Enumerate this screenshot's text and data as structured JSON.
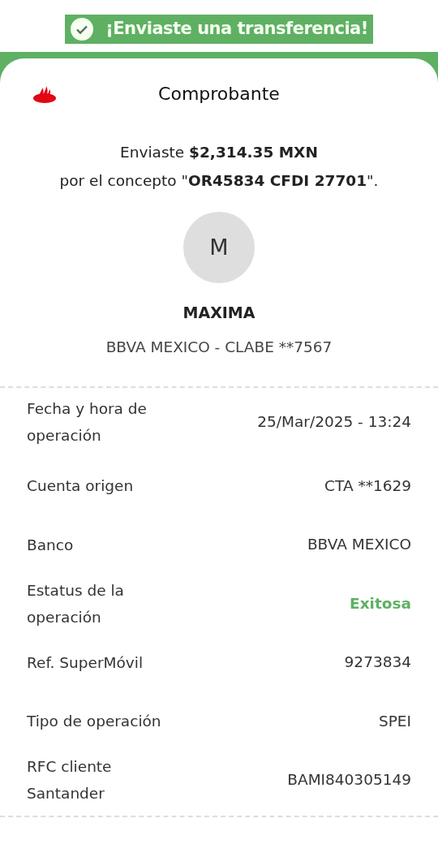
{
  "banner": {
    "text": "¡Enviaste una transferencia!"
  },
  "header": {
    "title": "Comprobante"
  },
  "summary": {
    "line_1": "Enviaste **$2,314.35 MXN**",
    "line_2": "por el concepto \"**OR45834 CFDI 27701**\"."
  },
  "recipient": {
    "initial": "M",
    "name": "MAXIMA",
    "account": "BBVA MEXICO - CLABE **7567"
  },
  "details": [
    {
      "label": "Fecha y hora de operación",
      "value": "25/Mar/2025 - 13:24",
      "kind": "text"
    },
    {
      "label": "Cuenta origen",
      "value": "CTA **1629",
      "kind": "text"
    },
    {
      "label": "Banco",
      "value": "BBVA MEXICO",
      "kind": "text"
    },
    {
      "label": "Estatus de la operación",
      "value": "Exitosa",
      "kind": "status"
    },
    {
      "label": "Ref. SuperMóvil",
      "value": "9273834",
      "kind": "text"
    },
    {
      "label": "Tipo de operación",
      "value": "SPEI",
      "kind": "text"
    },
    {
      "label": "RFC cliente Santander",
      "value": "BAMI840305149",
      "kind": "text"
    }
  ]
}
